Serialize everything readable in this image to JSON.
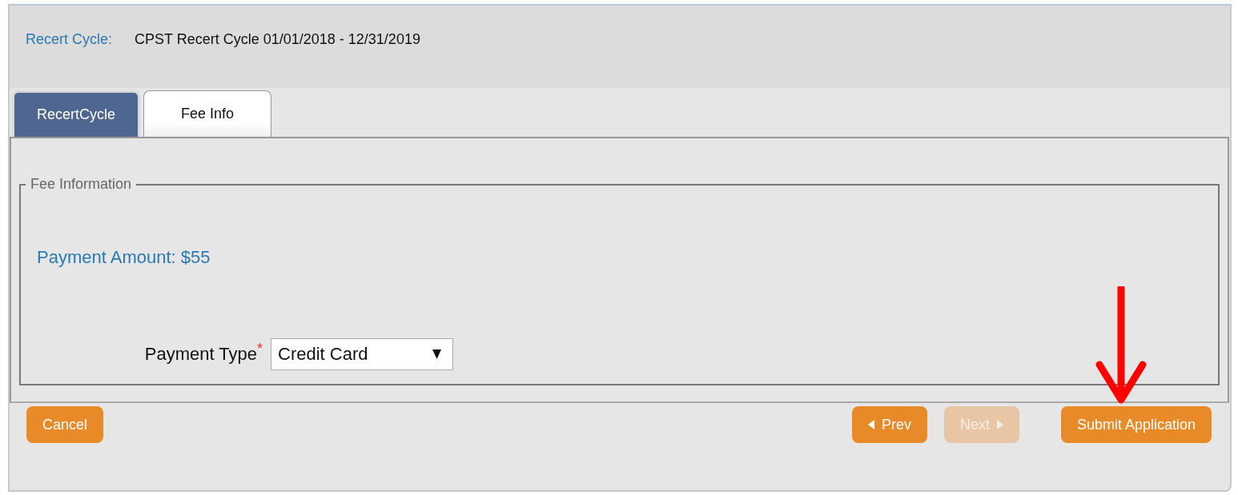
{
  "header": {
    "label": "Recert Cycle:",
    "value": "CPST Recert Cycle 01/01/2018 - 12/31/2019"
  },
  "tabs": [
    {
      "label": "RecertCycle",
      "selected": false
    },
    {
      "label": "Fee Info",
      "selected": true
    }
  ],
  "fee_information": {
    "legend": "Fee Information",
    "amount": "Payment Amount: $55",
    "fields": [
      {
        "label": "Payment Type",
        "required": true,
        "required_mark": "*",
        "value": "Credit Card"
      }
    ]
  },
  "left_buttons": [
    {
      "label": "Cancel",
      "kind": "plain",
      "disabled": false
    }
  ],
  "right_buttons": [
    {
      "label": "Prev",
      "kind": "prev",
      "disabled": false
    },
    {
      "label": "Next",
      "kind": "next",
      "disabled": true
    },
    {
      "label": "Submit Application",
      "kind": "plain",
      "disabled": false
    }
  ]
}
